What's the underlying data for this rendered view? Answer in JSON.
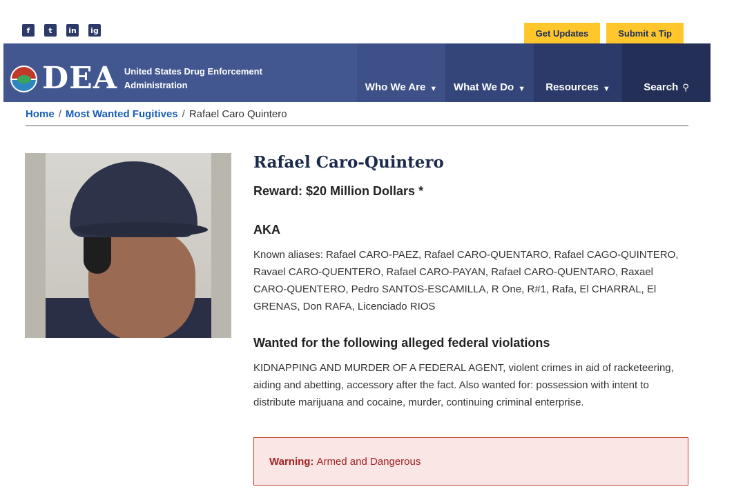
{
  "social": [
    "f",
    "t",
    "in",
    "ig"
  ],
  "social_icons": [
    "facebook-icon",
    "twitter-icon",
    "linkedin-icon",
    "instagram-icon"
  ],
  "utility": {
    "get_updates": "Get Updates",
    "submit_tip": "Submit a Tip"
  },
  "brand": {
    "logo_text": "DEA",
    "agency": "United States Drug Enforcement Administration"
  },
  "nav": {
    "items": [
      {
        "label": "Who We Are",
        "icon": "chevron-down-icon"
      },
      {
        "label": "What We Do",
        "icon": "chevron-down-icon"
      },
      {
        "label": "Resources",
        "icon": "chevron-down-icon"
      },
      {
        "label": "Search",
        "icon": "search-icon"
      }
    ]
  },
  "breadcrumb": {
    "home": "Home",
    "section": "Most Wanted Fugitives",
    "current": "Rafael Caro Quintero"
  },
  "fugitive": {
    "name": "Rafael Caro-Quintero",
    "reward": "Reward: $20 Million Dollars *",
    "aka_heading": "AKA",
    "aliases": "Known aliases: Rafael CARO-PAEZ, Rafael CARO-QUENTARO, Rafael CAGO-QUINTERO, Ravael CARO-QUENTERO, Rafael CARO-PAYAN, Rafael CARO-QUENTARO, Raxael CARO-QUENTERO, Pedro SANTOS-ESCAMILLA, R One, R#1, Rafa, El CHARRAL, El GRENAS, Don RAFA, Licenciado RIOS",
    "violations_heading": "Wanted for the following alleged federal violations",
    "violations": "KIDNAPPING AND MURDER OF A FEDERAL AGENT, violent crimes in aid of racketeering, aiding and abetting, accessory after the fact. Also wanted for: possession with intent to distribute marijuana and cocaine, murder, continuing criminal enterprise.",
    "warning_label": "Warning:",
    "warning_text": "Armed and Dangerous"
  },
  "colors": {
    "header": "#42578f",
    "accent_yellow": "#ffc72c",
    "link": "#1a5db5",
    "warning_bg": "#fbe6e6",
    "warning_text": "#a32020"
  }
}
